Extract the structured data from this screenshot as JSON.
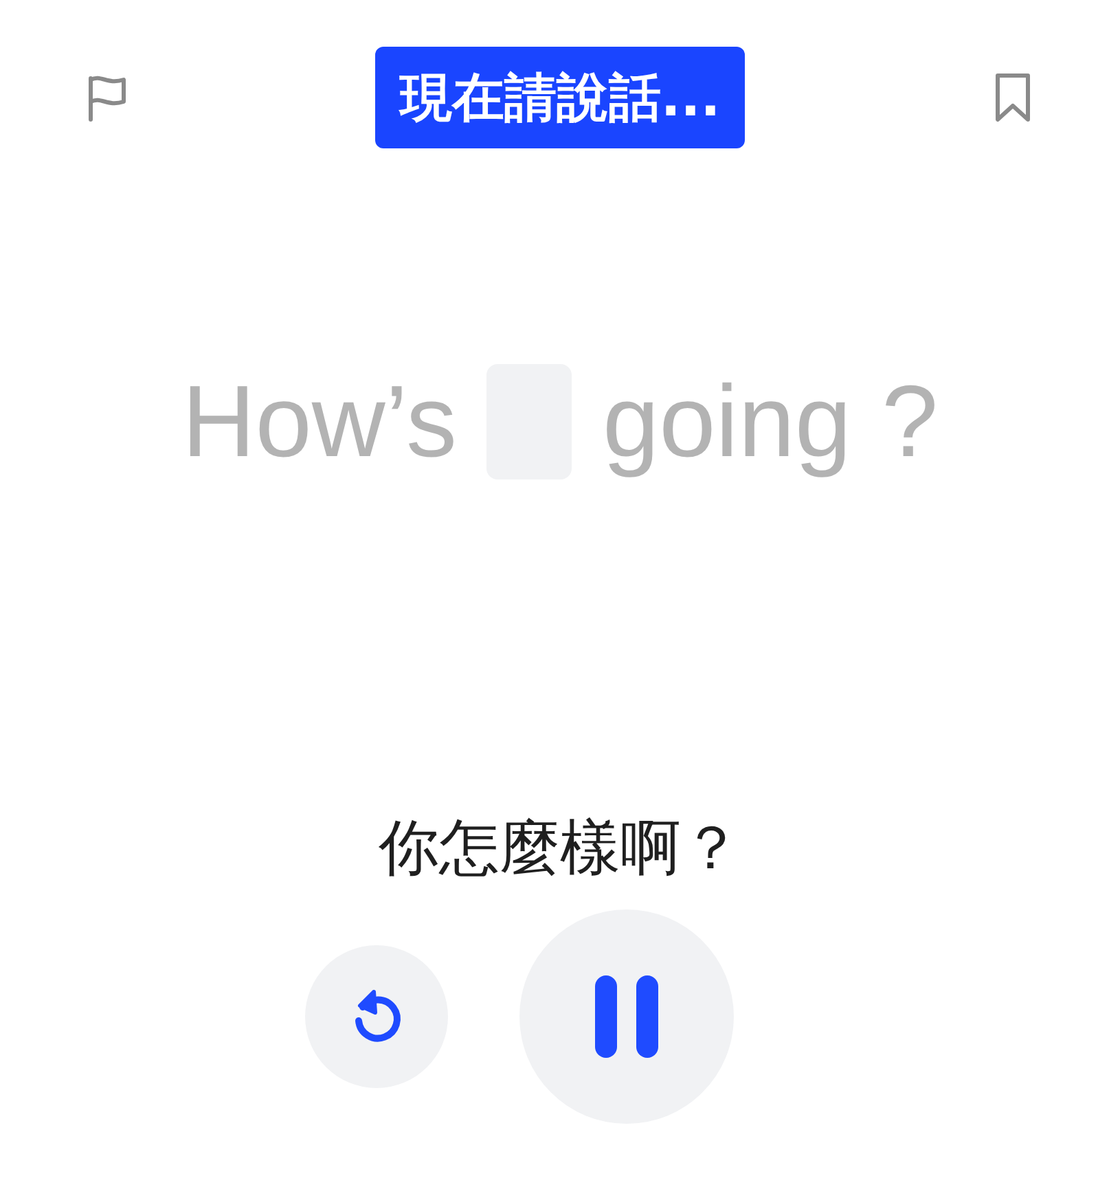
{
  "banner": {
    "text": "現在請說話..."
  },
  "sentence": [
    {
      "kind": "word",
      "text": "How’s"
    },
    {
      "kind": "blank"
    },
    {
      "kind": "word",
      "text": "going"
    },
    {
      "kind": "word",
      "text": "?"
    }
  ],
  "translation": "你怎麼樣啊？",
  "controls": [
    {
      "kind": "replay"
    },
    {
      "kind": "pause"
    }
  ]
}
